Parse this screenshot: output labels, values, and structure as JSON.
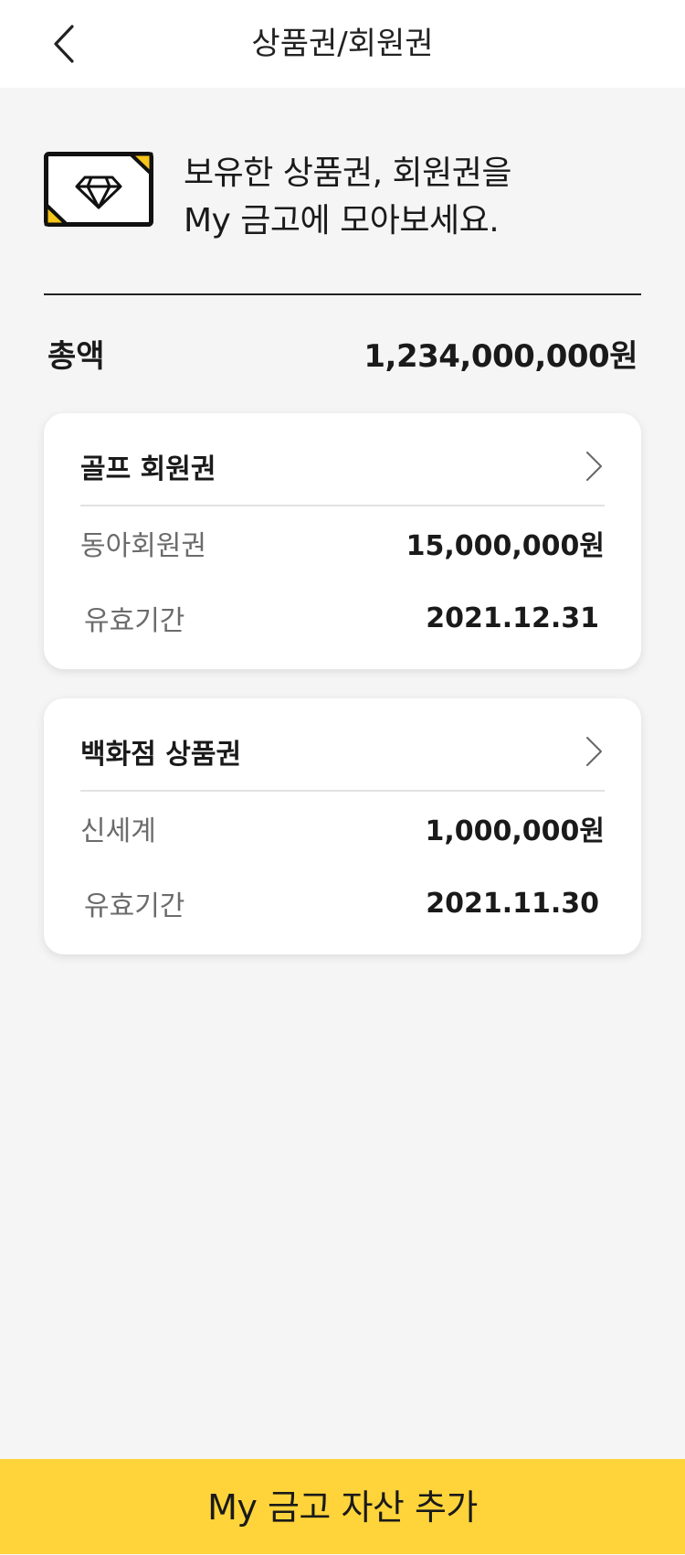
{
  "header": {
    "title": "상품권/회원권",
    "back_icon": "chevron-left-icon"
  },
  "intro": {
    "icon": "diamond-ticket-icon",
    "line1": "보유한 상품권, 회원권을",
    "line2": "My 금고에 모아보세요.",
    "colors": {
      "accent": "#f5c518",
      "frame": "#111111"
    }
  },
  "total": {
    "label": "총액",
    "value": "1,234,000,000원"
  },
  "cards": [
    {
      "title": "골프 회원권",
      "name_label": "동아회원권",
      "amount": "15,000,000원",
      "expiry_label": "유효기간",
      "expiry": "2021.12.31"
    },
    {
      "title": "백화점 상품권",
      "name_label": "신세계",
      "amount": "1,000,000원",
      "expiry_label": "유효기간",
      "expiry": "2021.11.30"
    }
  ],
  "footer": {
    "button_label": "My 금고 자산 추가",
    "color": "#ffd43a"
  }
}
